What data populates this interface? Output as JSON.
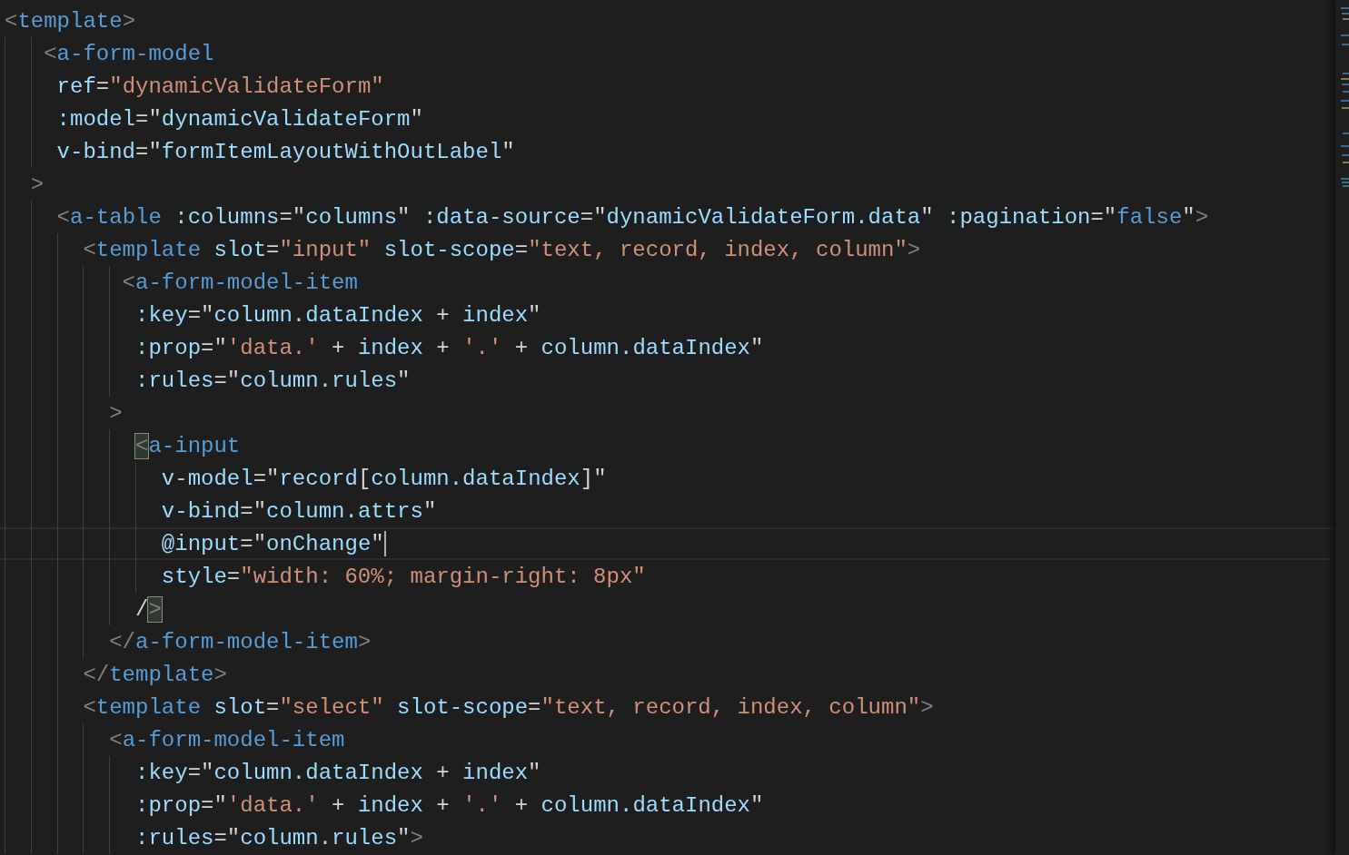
{
  "editor": {
    "lines": [
      {
        "current": false,
        "tokens": [
          {
            "kind": "punct",
            "text": "<"
          },
          {
            "kind": "tag",
            "text": "template"
          },
          {
            "kind": "punct",
            "text": ">"
          }
        ]
      },
      {
        "current": false,
        "tokens": [
          {
            "kind": "punct",
            "text": "   <"
          },
          {
            "kind": "tag",
            "text": "a-form-model"
          }
        ]
      },
      {
        "current": false,
        "tokens": [
          {
            "kind": "attr",
            "text": "    ref"
          },
          {
            "kind": "plain",
            "text": "="
          },
          {
            "kind": "string",
            "text": "\"dynamicValidateForm\""
          }
        ]
      },
      {
        "current": false,
        "tokens": [
          {
            "kind": "attr",
            "text": "    :model"
          },
          {
            "kind": "plain",
            "text": "=\""
          },
          {
            "kind": "expr",
            "text": "dynamicValidateForm"
          },
          {
            "kind": "plain",
            "text": "\""
          }
        ]
      },
      {
        "current": false,
        "tokens": [
          {
            "kind": "attr",
            "text": "    v-bind"
          },
          {
            "kind": "plain",
            "text": "=\""
          },
          {
            "kind": "expr",
            "text": "formItemLayoutWithOutLabel"
          },
          {
            "kind": "plain",
            "text": "\""
          }
        ]
      },
      {
        "current": false,
        "tokens": [
          {
            "kind": "punct",
            "text": "  >"
          }
        ]
      },
      {
        "current": false,
        "tokens": [
          {
            "kind": "punct",
            "text": "    <"
          },
          {
            "kind": "tag",
            "text": "a-table"
          },
          {
            "kind": "attr",
            "text": " :columns"
          },
          {
            "kind": "plain",
            "text": "=\""
          },
          {
            "kind": "expr",
            "text": "columns"
          },
          {
            "kind": "plain",
            "text": "\" "
          },
          {
            "kind": "attr",
            "text": ":data-source"
          },
          {
            "kind": "plain",
            "text": "=\""
          },
          {
            "kind": "expr",
            "text": "dynamicValidateForm.data"
          },
          {
            "kind": "plain",
            "text": "\" "
          },
          {
            "kind": "attr",
            "text": ":pagination"
          },
          {
            "kind": "plain",
            "text": "=\""
          },
          {
            "kind": "keyword",
            "text": "false"
          },
          {
            "kind": "plain",
            "text": "\""
          },
          {
            "kind": "punct",
            "text": ">"
          }
        ]
      },
      {
        "current": false,
        "tokens": [
          {
            "kind": "punct",
            "text": "      <"
          },
          {
            "kind": "tag",
            "text": "template"
          },
          {
            "kind": "attr",
            "text": " slot"
          },
          {
            "kind": "plain",
            "text": "="
          },
          {
            "kind": "string",
            "text": "\"input\""
          },
          {
            "kind": "attr",
            "text": " slot-scope"
          },
          {
            "kind": "plain",
            "text": "="
          },
          {
            "kind": "string",
            "text": "\"text, record, index, column\""
          },
          {
            "kind": "punct",
            "text": ">"
          }
        ]
      },
      {
        "current": false,
        "tokens": [
          {
            "kind": "punct",
            "text": "         <"
          },
          {
            "kind": "tag",
            "text": "a-form-model-item"
          }
        ]
      },
      {
        "current": false,
        "tokens": [
          {
            "kind": "attr",
            "text": "          :key"
          },
          {
            "kind": "plain",
            "text": "=\""
          },
          {
            "kind": "expr",
            "text": "column.dataIndex"
          },
          {
            "kind": "plain",
            "text": " + "
          },
          {
            "kind": "expr",
            "text": "index"
          },
          {
            "kind": "plain",
            "text": "\""
          }
        ]
      },
      {
        "current": false,
        "tokens": [
          {
            "kind": "attr",
            "text": "          :prop"
          },
          {
            "kind": "plain",
            "text": "=\""
          },
          {
            "kind": "string",
            "text": "'data.'"
          },
          {
            "kind": "plain",
            "text": " + "
          },
          {
            "kind": "expr",
            "text": "index"
          },
          {
            "kind": "plain",
            "text": " + "
          },
          {
            "kind": "string",
            "text": "'.'"
          },
          {
            "kind": "plain",
            "text": " + "
          },
          {
            "kind": "expr",
            "text": "column.dataIndex"
          },
          {
            "kind": "plain",
            "text": "\""
          }
        ]
      },
      {
        "current": false,
        "tokens": [
          {
            "kind": "attr",
            "text": "          :rules"
          },
          {
            "kind": "plain",
            "text": "=\""
          },
          {
            "kind": "expr",
            "text": "column.rules"
          },
          {
            "kind": "plain",
            "text": "\""
          }
        ]
      },
      {
        "current": false,
        "tokens": [
          {
            "kind": "punct",
            "text": "        >"
          }
        ]
      },
      {
        "current": false,
        "tokens": [
          {
            "kind": "match",
            "text": "          <"
          },
          {
            "kind": "tag",
            "text": "a-input"
          }
        ]
      },
      {
        "current": false,
        "tokens": [
          {
            "kind": "attr",
            "text": "            v-model"
          },
          {
            "kind": "plain",
            "text": "=\""
          },
          {
            "kind": "expr",
            "text": "record"
          },
          {
            "kind": "plain",
            "text": "["
          },
          {
            "kind": "expr",
            "text": "column.dataIndex"
          },
          {
            "kind": "plain",
            "text": "]\""
          }
        ]
      },
      {
        "current": false,
        "tokens": [
          {
            "kind": "attr",
            "text": "            v-bind"
          },
          {
            "kind": "plain",
            "text": "=\""
          },
          {
            "kind": "expr",
            "text": "column.attrs"
          },
          {
            "kind": "plain",
            "text": "\""
          }
        ]
      },
      {
        "current": true,
        "tokens": [
          {
            "kind": "attr",
            "text": "            @input"
          },
          {
            "kind": "plain",
            "text": "=\""
          },
          {
            "kind": "expr",
            "text": "onChange"
          },
          {
            "kind": "plain",
            "text": "\""
          }
        ]
      },
      {
        "current": false,
        "tokens": [
          {
            "kind": "attr",
            "text": "            style"
          },
          {
            "kind": "plain",
            "text": "="
          },
          {
            "kind": "string",
            "text": "\"width: 60%; margin-right: 8px\""
          }
        ]
      },
      {
        "current": false,
        "tokens": [
          {
            "kind": "plain",
            "text": "          /"
          },
          {
            "kind": "match",
            "text": ">"
          }
        ]
      },
      {
        "current": false,
        "tokens": [
          {
            "kind": "punct",
            "text": "        </"
          },
          {
            "kind": "tag",
            "text": "a-form-model-item"
          },
          {
            "kind": "punct",
            "text": ">"
          }
        ]
      },
      {
        "current": false,
        "tokens": [
          {
            "kind": "punct",
            "text": "      </"
          },
          {
            "kind": "tag",
            "text": "template"
          },
          {
            "kind": "punct",
            "text": ">"
          }
        ]
      },
      {
        "current": false,
        "tokens": [
          {
            "kind": "punct",
            "text": "      <"
          },
          {
            "kind": "tag",
            "text": "template"
          },
          {
            "kind": "attr",
            "text": " slot"
          },
          {
            "kind": "plain",
            "text": "="
          },
          {
            "kind": "string",
            "text": "\"select\""
          },
          {
            "kind": "attr",
            "text": " slot-scope"
          },
          {
            "kind": "plain",
            "text": "="
          },
          {
            "kind": "string",
            "text": "\"text, record, index, column\""
          },
          {
            "kind": "punct",
            "text": ">"
          }
        ]
      },
      {
        "current": false,
        "tokens": [
          {
            "kind": "punct",
            "text": "        <"
          },
          {
            "kind": "tag",
            "text": "a-form-model-item"
          }
        ]
      },
      {
        "current": false,
        "tokens": [
          {
            "kind": "attr",
            "text": "          :key"
          },
          {
            "kind": "plain",
            "text": "=\""
          },
          {
            "kind": "expr",
            "text": "column.dataIndex"
          },
          {
            "kind": "plain",
            "text": " + "
          },
          {
            "kind": "expr",
            "text": "index"
          },
          {
            "kind": "plain",
            "text": "\""
          }
        ]
      },
      {
        "current": false,
        "tokens": [
          {
            "kind": "attr",
            "text": "          :prop"
          },
          {
            "kind": "plain",
            "text": "=\""
          },
          {
            "kind": "string",
            "text": "'data.'"
          },
          {
            "kind": "plain",
            "text": " + "
          },
          {
            "kind": "expr",
            "text": "index"
          },
          {
            "kind": "plain",
            "text": " + "
          },
          {
            "kind": "string",
            "text": "'.'"
          },
          {
            "kind": "plain",
            "text": " + "
          },
          {
            "kind": "expr",
            "text": "column.dataIndex"
          },
          {
            "kind": "plain",
            "text": "\""
          }
        ]
      },
      {
        "current": false,
        "tokens": [
          {
            "kind": "attr",
            "text": "          :rules"
          },
          {
            "kind": "plain",
            "text": "=\""
          },
          {
            "kind": "expr",
            "text": "column.rules"
          },
          {
            "kind": "plain",
            "text": "\""
          },
          {
            "kind": "punct",
            "text": ">"
          }
        ]
      }
    ]
  }
}
